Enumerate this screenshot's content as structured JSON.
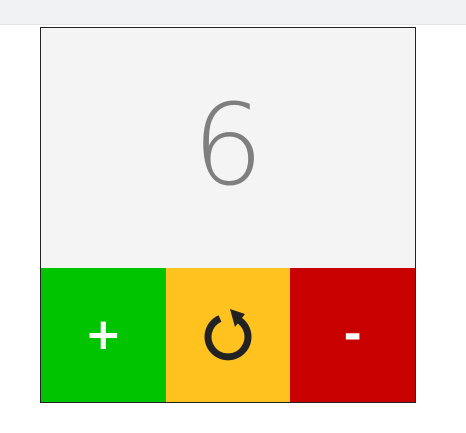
{
  "counter": {
    "value": "6",
    "increment_label": "+",
    "decrement_label": "-",
    "reset_icon": "reset-icon"
  },
  "colors": {
    "increment": "#00c400",
    "reset": "#ffc21f",
    "decrement": "#c80000",
    "display_bg": "#f4f4f5",
    "value_text": "#7f7f7f"
  }
}
